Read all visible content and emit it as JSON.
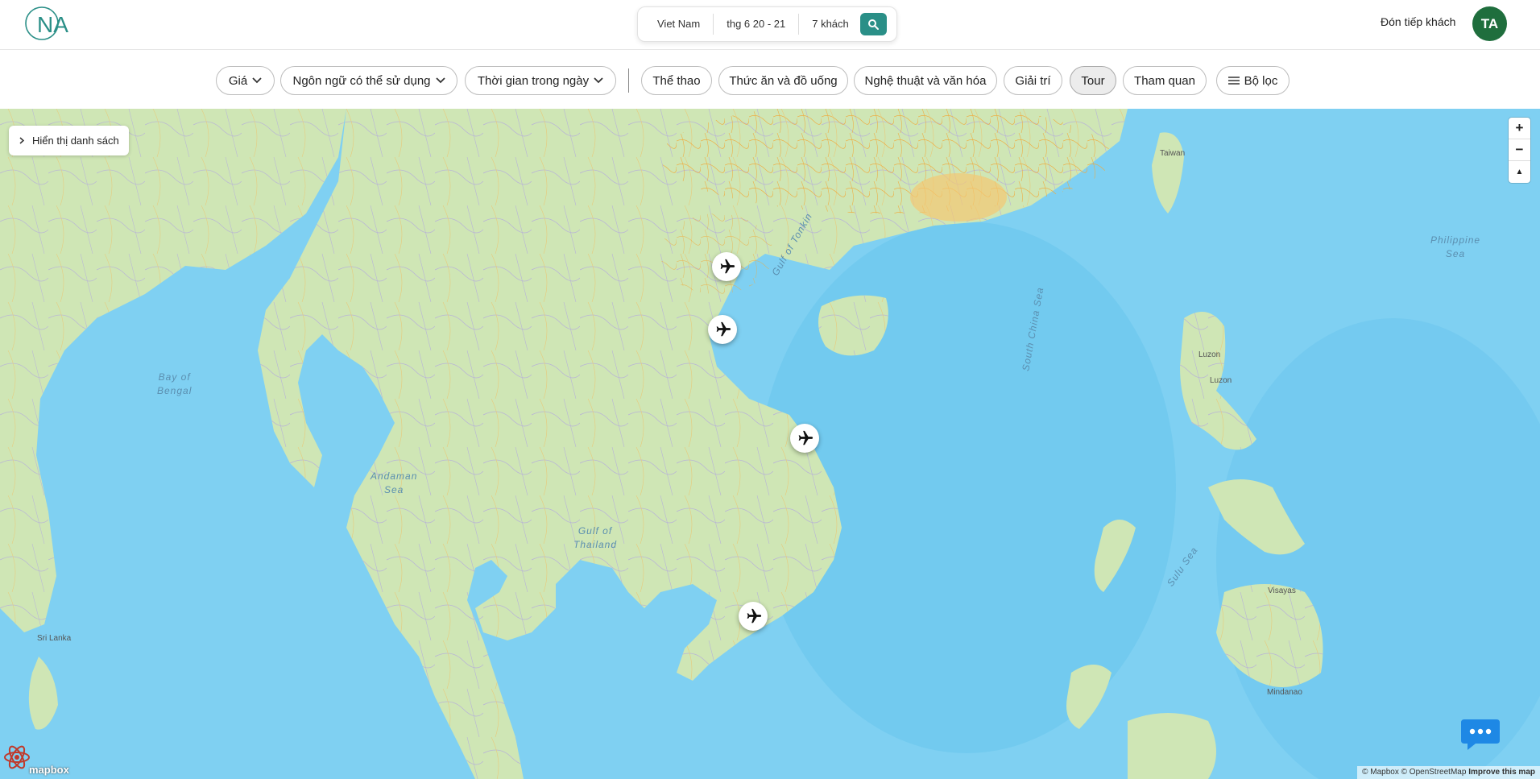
{
  "header": {
    "logo_text": "NA",
    "search": {
      "location": "Viet Nam",
      "dates": "thg 6 20 - 21",
      "guests": "7 khách"
    },
    "host_link": "Đón tiếp khách",
    "avatar_initials": "TA"
  },
  "filters": {
    "dropdowns": [
      {
        "label": "Giá"
      },
      {
        "label": "Ngôn ngữ có thể sử dụng"
      },
      {
        "label": "Thời gian trong ngày"
      }
    ],
    "categories": [
      {
        "label": "Thể thao",
        "active": false
      },
      {
        "label": "Thức ăn và đồ uống",
        "active": false
      },
      {
        "label": "Nghệ thuật và văn hóa",
        "active": false
      },
      {
        "label": "Giải trí",
        "active": false
      },
      {
        "label": "Tour",
        "active": true
      },
      {
        "label": "Tham quan",
        "active": false
      }
    ],
    "more_filters": "Bộ lọc"
  },
  "map": {
    "list_toggle": "Hiển thị danh sách",
    "zoom_in": "+",
    "zoom_out": "−",
    "compass": "▲",
    "water_labels": {
      "bay_of_bengal_1": "Bay of",
      "bay_of_bengal_2": "Bengal",
      "andaman_1": "Andaman",
      "andaman_2": "Sea",
      "gulf_thailand_1": "Gulf of",
      "gulf_thailand_2": "Thailand",
      "gulf_tonkin": "Gulf of Tonkin",
      "south_china_sea": "South China Sea",
      "philippine_1": "Philippine",
      "philippine_2": "Sea",
      "sulu_sea": "Sulu Sea"
    },
    "places": {
      "taiwan": "Taiwan",
      "luzon_1": "Luzon",
      "luzon_2": "Luzon",
      "visayas": "Visayas",
      "mindanao": "Mindanao",
      "sri_lanka": "Sri Lanka"
    },
    "markers_icon": "airplane-icon",
    "attribution": {
      "mapbox": "© Mapbox",
      "osm": "© OpenStreetMap",
      "improve": "Improve this map"
    },
    "mapbox_logo": "mapbox"
  },
  "colors": {
    "accent": "#2a8f87",
    "avatar": "#1f6e3d",
    "sea": "#7fd0f2",
    "land": "#cfe6b5",
    "chat": "#1e88e5"
  }
}
